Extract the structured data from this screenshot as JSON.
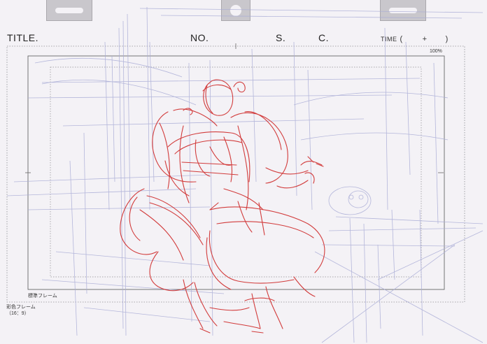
{
  "header": {
    "title_label": "TITLE.",
    "no_label": "NO.",
    "s_label": "S.",
    "c_label": "C.",
    "time_label": "TIME",
    "time_open": "(",
    "time_plus": "+",
    "time_close": ")"
  },
  "frame": {
    "zoom": "100%",
    "standard_frame_label": "標準フレーム",
    "color_frame_label": "彩色フレーム",
    "color_frame_ratio": "（16：9）"
  },
  "colors": {
    "paper": "#f4f2f6",
    "sketch_red": "#d23c3c",
    "guide_blue": "#a9acd6",
    "frame_line": "#555555"
  }
}
